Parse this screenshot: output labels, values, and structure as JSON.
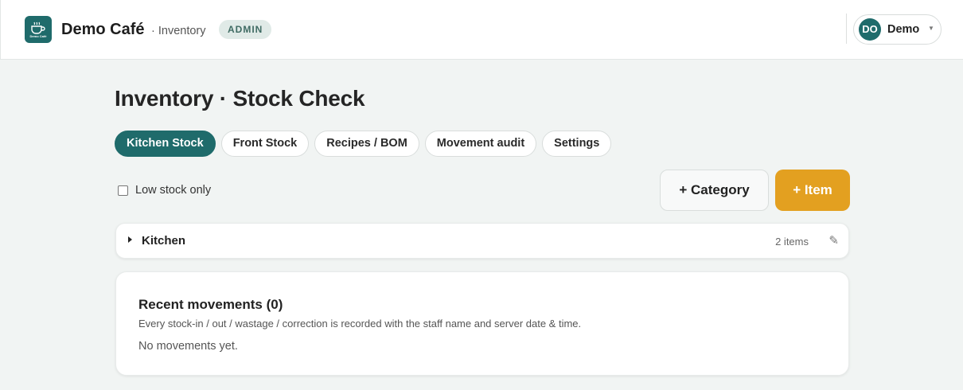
{
  "header": {
    "logo_text": "Demo Café",
    "brand_name": "Demo Café",
    "section": "· Inventory",
    "role_badge": "ADMIN",
    "user": {
      "initials": "DO",
      "name": "Demo"
    }
  },
  "page": {
    "title": "Inventory · Stock Check"
  },
  "tabs": [
    {
      "label": "Kitchen Stock",
      "active": true
    },
    {
      "label": "Front Stock",
      "active": false
    },
    {
      "label": "Recipes / BOM",
      "active": false
    },
    {
      "label": "Movement audit",
      "active": false
    },
    {
      "label": "Settings",
      "active": false
    }
  ],
  "filters": {
    "low_stock_label": "Low stock only",
    "low_stock_checked": false
  },
  "actions": {
    "add_category": "+ Category",
    "add_item": "+ Item"
  },
  "categories": [
    {
      "name": "Kitchen",
      "count": "2 items"
    }
  ],
  "movements": {
    "title": "Recent movements (0)",
    "subtitle": "Every stock-in / out / wastage / correction is recorded with the staff name and server date & time.",
    "empty": "No movements yet."
  },
  "colors": {
    "brand": "#1f6b6b",
    "accent": "#e3a020",
    "badge_bg": "#e0eae7"
  },
  "icons": [
    "coffee-cup-icon",
    "caret-down-icon",
    "expand-triangle-icon",
    "pencil-icon"
  ]
}
